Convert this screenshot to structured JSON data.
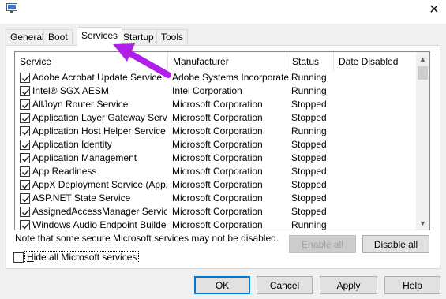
{
  "tabs": [
    {
      "label": "General"
    },
    {
      "label": "Boot"
    },
    {
      "label": "Services"
    },
    {
      "label": "Startup"
    },
    {
      "label": "Tools"
    }
  ],
  "columns": {
    "service": "Service",
    "manufacturer": "Manufacturer",
    "status": "Status",
    "date_disabled": "Date Disabled"
  },
  "services": [
    {
      "name": "Adobe Acrobat Update Service",
      "manufacturer": "Adobe Systems Incorporated",
      "status": "Running",
      "checked": true
    },
    {
      "name": "Intel® SGX AESM",
      "manufacturer": "Intel Corporation",
      "status": "Running",
      "checked": true
    },
    {
      "name": "AllJoyn Router Service",
      "manufacturer": "Microsoft Corporation",
      "status": "Stopped",
      "checked": true
    },
    {
      "name": "Application Layer Gateway Service",
      "manufacturer": "Microsoft Corporation",
      "status": "Stopped",
      "checked": true
    },
    {
      "name": "Application Host Helper Service",
      "manufacturer": "Microsoft Corporation",
      "status": "Running",
      "checked": true
    },
    {
      "name": "Application Identity",
      "manufacturer": "Microsoft Corporation",
      "status": "Stopped",
      "checked": true
    },
    {
      "name": "Application Management",
      "manufacturer": "Microsoft Corporation",
      "status": "Stopped",
      "checked": true
    },
    {
      "name": "App Readiness",
      "manufacturer": "Microsoft Corporation",
      "status": "Stopped",
      "checked": true
    },
    {
      "name": "AppX Deployment Service (AppX...",
      "manufacturer": "Microsoft Corporation",
      "status": "Stopped",
      "checked": true
    },
    {
      "name": "ASP.NET State Service",
      "manufacturer": "Microsoft Corporation",
      "status": "Stopped",
      "checked": true
    },
    {
      "name": "AssignedAccessManager Service",
      "manufacturer": "Microsoft Corporation",
      "status": "Stopped",
      "checked": true
    },
    {
      "name": "Windows Audio Endpoint Builder",
      "manufacturer": "Microsoft Corporation",
      "status": "Running",
      "checked": true
    }
  ],
  "note": "Note that some secure Microsoft services may not be disabled.",
  "enable_all": {
    "first": "E",
    "rest": "nable all",
    "disabled": true
  },
  "disable_all": {
    "first": "D",
    "rest": "isable all"
  },
  "hide_ms": {
    "first": "H",
    "rest": "ide all Microsoft services",
    "checked": false
  },
  "footer": {
    "ok": "OK",
    "cancel": "Cancel",
    "apply_first": "A",
    "apply_rest": "pply",
    "help": "Help"
  },
  "colors": {
    "annotation_arrow": "#b01ee8",
    "default_button_border": "#0078d7"
  }
}
